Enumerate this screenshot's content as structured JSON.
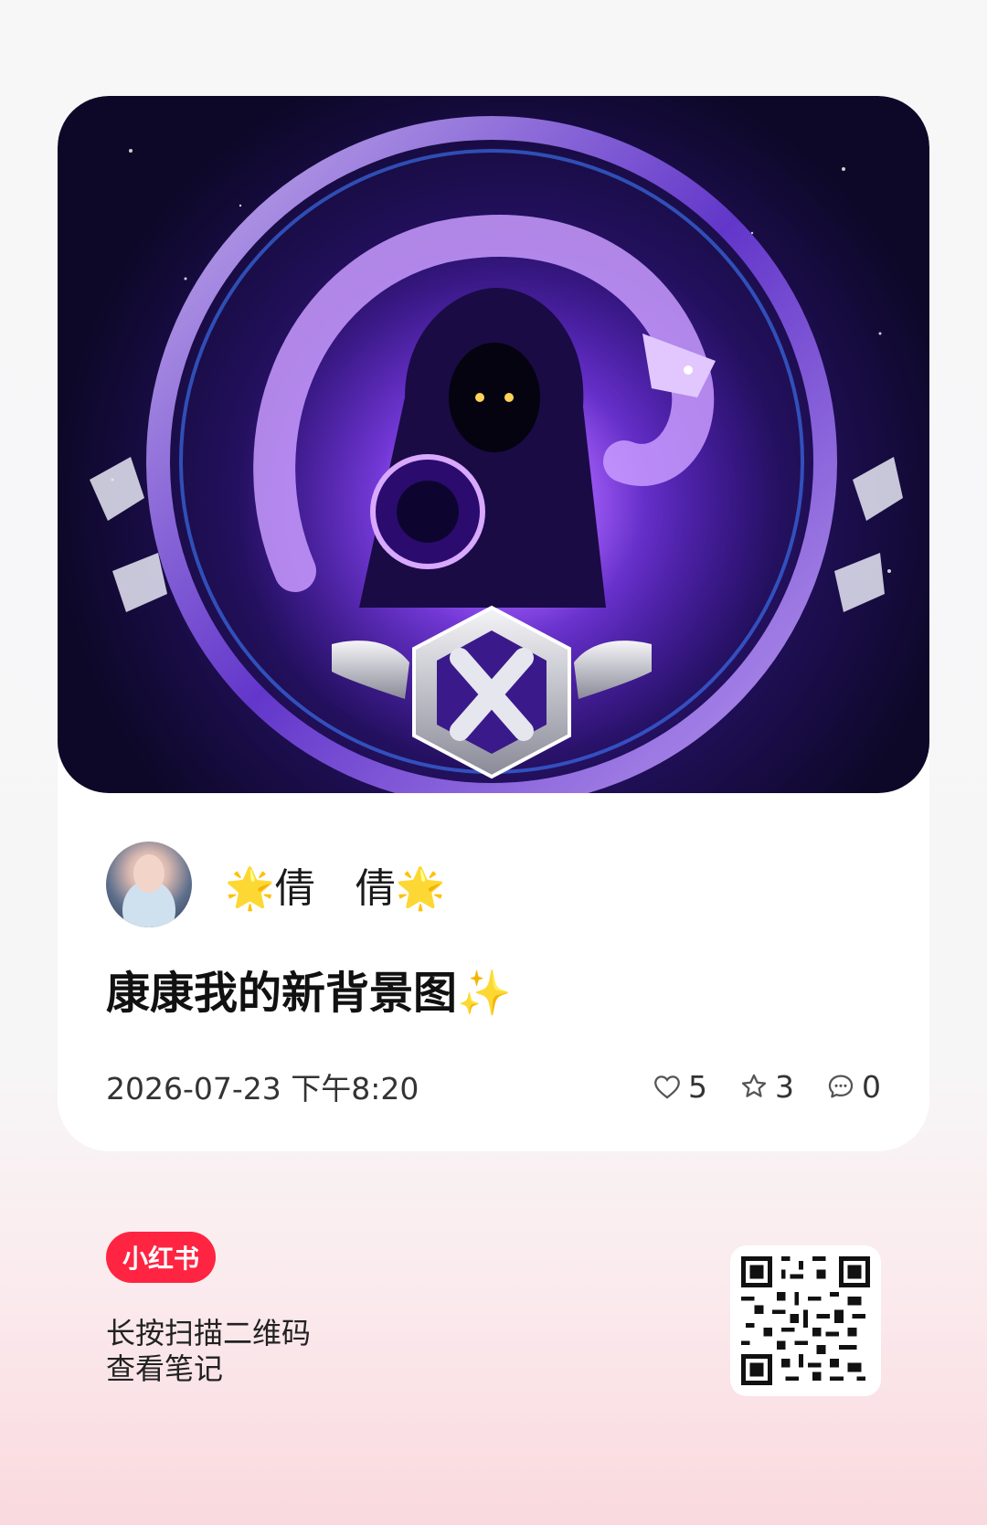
{
  "note": {
    "cover_image": "purple hooded figure with dragon emblem",
    "author": {
      "name": "🌟倩　倩🌟",
      "avatar": "avatar"
    },
    "title": "康康我的新背景图✨",
    "date": "2026-07-23 下午8:20",
    "stats": [
      {
        "icon": "heart-icon",
        "value": "5"
      },
      {
        "icon": "star-icon",
        "value": "3"
      },
      {
        "icon": "comment-icon",
        "value": "0"
      }
    ]
  },
  "footer": {
    "brand": "小红书",
    "hint_line1": "长按扫描二维码",
    "hint_line2": "查看笔记",
    "qr": "qr-code"
  },
  "colors": {
    "brand_red": "#ff2442",
    "cover_purple": "#5b24c8"
  }
}
